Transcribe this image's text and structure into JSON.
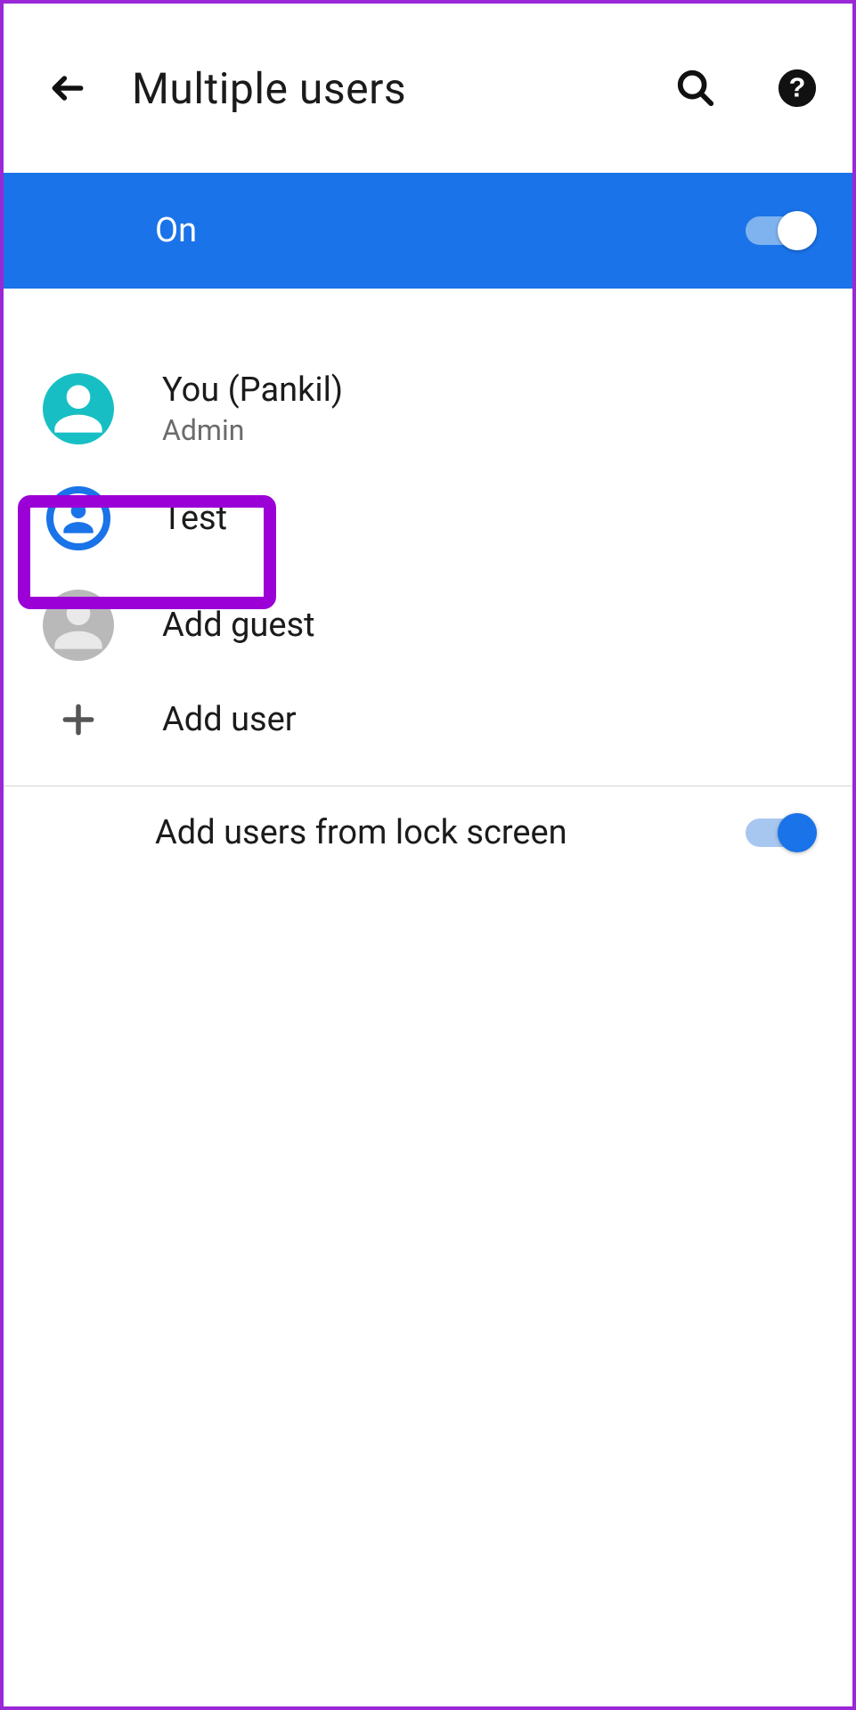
{
  "header": {
    "title": "Multiple users"
  },
  "master_toggle": {
    "label": "On",
    "state": "on"
  },
  "users": {
    "you": {
      "name": "You (Pankil)",
      "role": "Admin"
    },
    "second": {
      "name": "Test"
    },
    "guest": {
      "label": "Add guest"
    },
    "add": {
      "label": "Add user"
    }
  },
  "lock_screen": {
    "label": "Add users from lock screen",
    "state": "on"
  }
}
